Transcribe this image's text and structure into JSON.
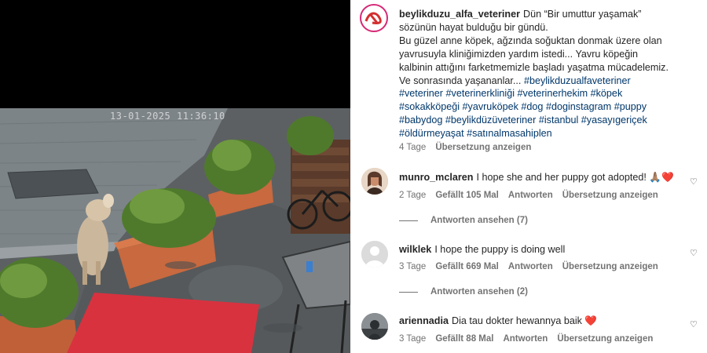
{
  "video": {
    "timestamp": "13-01-2025 11:36:10"
  },
  "caption": {
    "username": "beylikduzu_alfa_veteriner",
    "line1": "Dün “Bir umuttur yaşamak” sözünün hayat bulduğu bir gündü.",
    "line2": "Bu güzel anne köpek, ağzında soğuktan donmak üzere olan yavrusuyla kliniğimizden yardım istedi... Yavru köpeğin kalbinin attığını farketmemizle başladı yaşatma mücadelemiz. Ve sonrasında yaşananlar...",
    "hashtags": [
      "#beylikduzualfaveteriner",
      "#veteriner",
      "#veterinerkliniği",
      "#veterinerhekim",
      "#köpek",
      "#sokakköpeği",
      "#yavruköpek",
      "#dog",
      "#doginstagram",
      "#puppy",
      "#babydog",
      "#beylikdüzüveteriner",
      "#istanbul",
      "#yasayıgeriçek",
      "#öldürmeyaşat",
      "#satınalmasahiplen"
    ],
    "time": "4 Tage",
    "translate": "Übersetzung anzeigen"
  },
  "comments": [
    {
      "username": "munro_mclaren",
      "text": "I hope she and her puppy got adopted! 🙏🏽❤️",
      "time": "2 Tage",
      "likes": "Gefällt 105 Mal",
      "reply": "Antworten",
      "translate": "Übersetzung anzeigen",
      "view_replies": "Antworten ansehen (7)",
      "avatar_icon": "profile-photo"
    },
    {
      "username": "wilklek",
      "text": "I hope the puppy is doing well",
      "time": "3 Tage",
      "likes": "Gefällt 669 Mal",
      "reply": "Antworten",
      "translate": "Übersetzung anzeigen",
      "view_replies": "Antworten ansehen (2)",
      "avatar_icon": "default-avatar"
    },
    {
      "username": "ariennadia",
      "text": "Dia tau dokter hewannya baik ❤️",
      "time": "3 Tage",
      "likes": "Gefällt 88 Mal",
      "reply": "Antworten",
      "translate": "Übersetzung anzeigen",
      "avatar_icon": "profile-photo"
    }
  ],
  "colors": {
    "hashtag": "#00376b",
    "meta": "#737373",
    "text": "#262626",
    "heart": "#e53935",
    "logo": "#d32f2f"
  }
}
